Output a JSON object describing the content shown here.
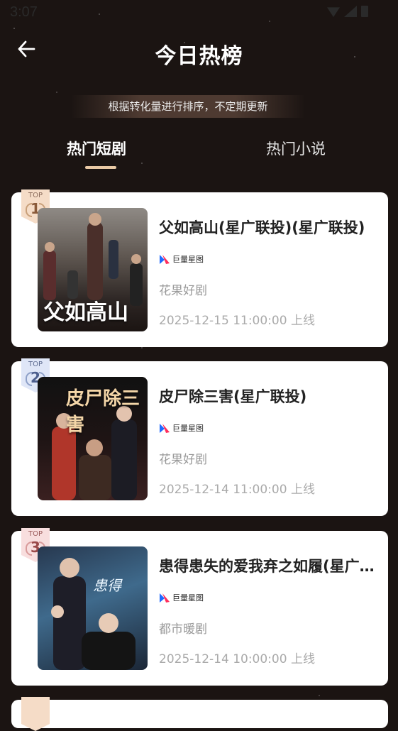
{
  "status_bar": {
    "time": "3:07"
  },
  "header": {
    "title": "今日热榜",
    "subtitle": "根据转化量进行排序，不定期更新"
  },
  "tabs": [
    {
      "label": "热门短剧",
      "active": true
    },
    {
      "label": "热门小说",
      "active": false
    }
  ],
  "items": [
    {
      "rank_label": "TOP",
      "rank": "1",
      "poster_title": "父如高山",
      "title": "父如高山(星广联投)(星广联投)",
      "brand": "巨量星图",
      "genre": "花果好剧",
      "date": "2025-12-15 11:00:00 上线",
      "badge_color": "#f5dcc7",
      "badge_text_color": "#8a5a3a"
    },
    {
      "rank_label": "TOP",
      "rank": "2",
      "poster_title": "皮尸除三害",
      "title": "皮尸除三害(星广联投)",
      "brand": "巨量星图",
      "genre": "花果好剧",
      "date": "2025-12-14 11:00:00 上线",
      "badge_color": "#dfe6f7",
      "badge_text_color": "#4d5f8e"
    },
    {
      "rank_label": "TOP",
      "rank": "3",
      "poster_title": "",
      "title": "患得患失的爱我弃之如履(星广联投)",
      "brand": "巨量星图",
      "genre": "都市暖剧",
      "date": "2025-12-14 10:00:00 上线",
      "badge_color": "#f8dede",
      "badge_text_color": "#9a4a4a"
    }
  ],
  "colors": {
    "background": "#1b1412",
    "tab_underline": "#e9c9a5",
    "card": "#ffffff"
  }
}
